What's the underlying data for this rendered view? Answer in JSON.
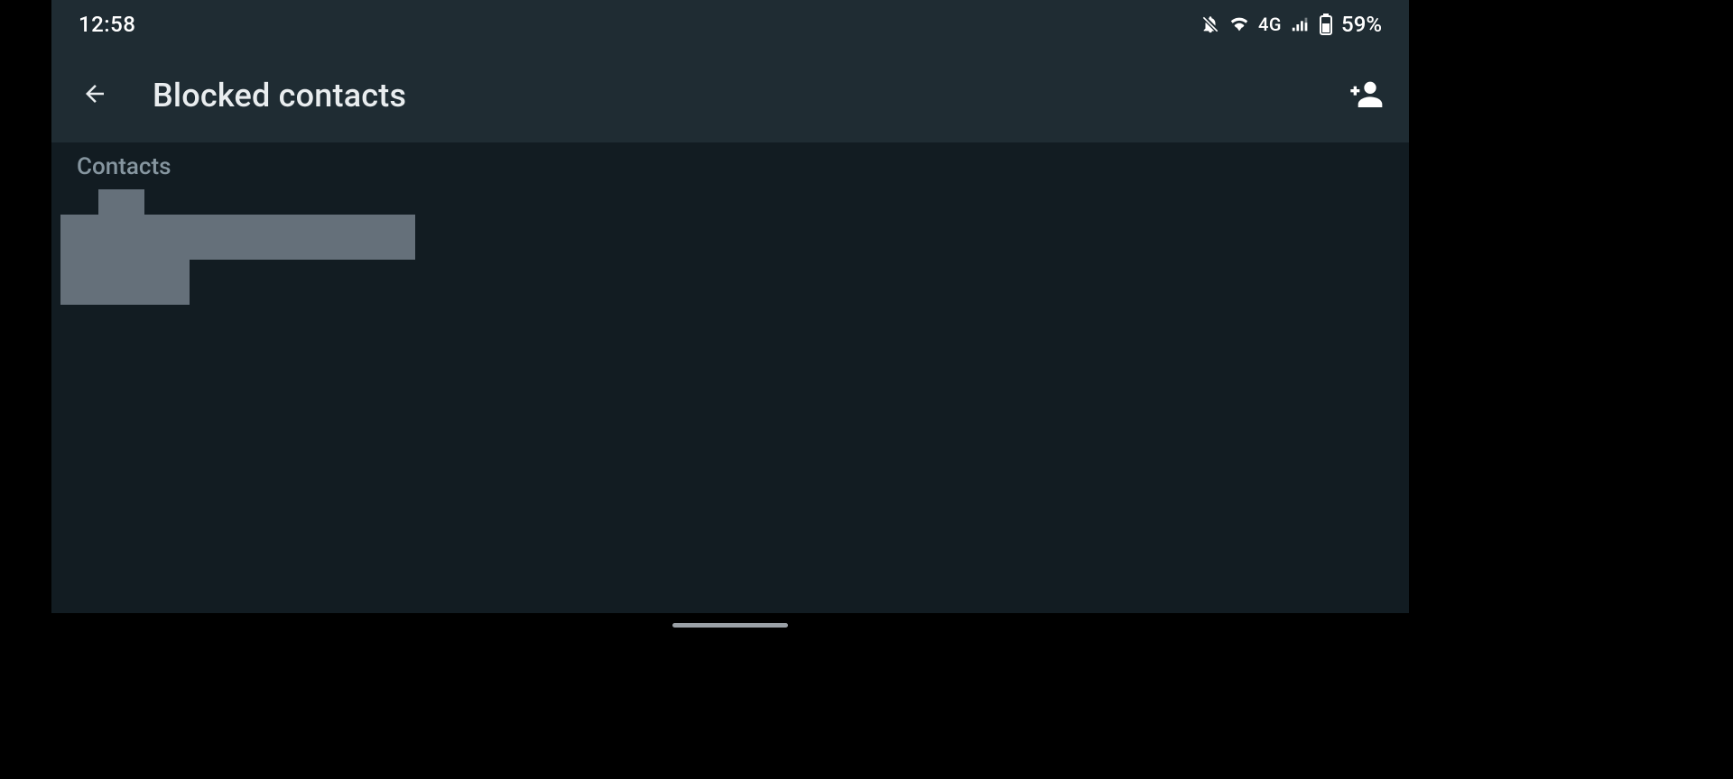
{
  "status": {
    "time": "12:58",
    "network_type": "4G",
    "battery_percent": "59%",
    "icons": {
      "notifications_off": "notifications-off-icon",
      "wifi": "wifi-icon",
      "signal": "cellular-signal-icon",
      "battery": "battery-icon"
    }
  },
  "appbar": {
    "title": "Blocked contacts",
    "back_label": "Back",
    "add_label": "Add contact"
  },
  "sections": {
    "contacts_header": "Contacts"
  },
  "contacts": [
    {
      "name_redacted": true
    }
  ]
}
